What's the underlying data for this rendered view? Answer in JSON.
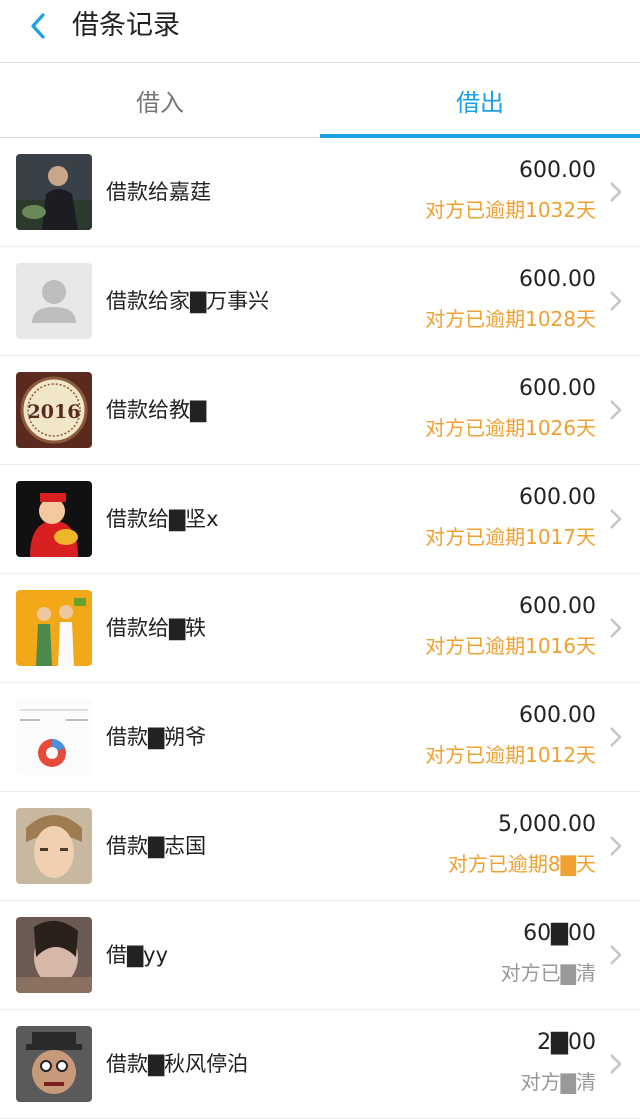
{
  "header": {
    "title": "借条记录",
    "back_icon": "chevron-left-icon"
  },
  "tabs": [
    {
      "label": "借入",
      "active": false
    },
    {
      "label": "借出",
      "active": true
    }
  ],
  "colors": {
    "accent": "#1aa0e6",
    "overdue": "#f0a030",
    "muted": "#999999"
  },
  "records": [
    {
      "name": "借款给嘉莛",
      "amount": "600.00",
      "status": "对方已逾期1032天",
      "status_type": "overdue",
      "avatar": "photo-man"
    },
    {
      "name": "借款给家▇万事兴",
      "amount": "600.00",
      "status": "对方已逾期1028天",
      "status_type": "overdue",
      "avatar": "default-user"
    },
    {
      "name": "借款给教▇",
      "amount": "600.00",
      "status": "对方已逾期1026天",
      "status_type": "overdue",
      "avatar": "2016-badge"
    },
    {
      "name": "借款给▇坚x",
      "amount": "600.00",
      "status": "对方已逾期1017天",
      "status_type": "overdue",
      "avatar": "fortune-god"
    },
    {
      "name": "借款给▇轶",
      "amount": "600.00",
      "status": "对方已逾期1016天",
      "status_type": "overdue",
      "avatar": "couple-photo"
    },
    {
      "name": "借款▇朔爷",
      "amount": "600.00",
      "status": "对方已逾期1012天",
      "status_type": "overdue",
      "avatar": "chart-screenshot"
    },
    {
      "name": "借款▇志国",
      "amount": "5,000.00",
      "status": "对方已逾期8▇天",
      "status_type": "overdue",
      "avatar": "photo-boy"
    },
    {
      "name": "借▇yy",
      "amount": "60▇00",
      "status": "对方已▇清",
      "status_type": "settled",
      "avatar": "photo-woman"
    },
    {
      "name": "借款▇秋风停泊",
      "amount": "2▇00",
      "status": "对方▇清",
      "status_type": "settled",
      "avatar": "cartoon-face"
    }
  ]
}
